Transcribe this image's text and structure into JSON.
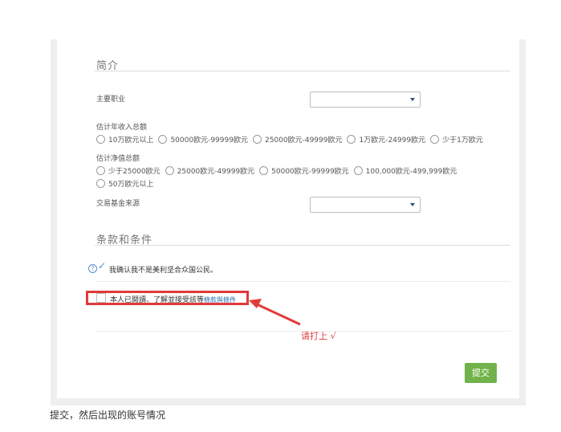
{
  "sections": {
    "intro_title": "简介",
    "terms_title": "条款和条件"
  },
  "occupation": {
    "label": "主要职业",
    "selected": ""
  },
  "annual_income": {
    "label": "估计年收入总额",
    "options": [
      "10万欧元以上",
      "50000欧元-99999欧元",
      "25000欧元-49999欧元",
      "1万欧元-24999欧元",
      "少于1万欧元"
    ]
  },
  "net_worth": {
    "label": "估计净值总额",
    "options": [
      "少于25000欧元",
      "25000欧元-49999欧元",
      "50000欧元-99999欧元",
      "100,000欧元-499,999欧元",
      "50万欧元以上"
    ]
  },
  "fund_source": {
    "label": "交易基金来源",
    "selected": ""
  },
  "terms": {
    "help_icon": "?",
    "confirm_text": "我确认我不是美利坚合众国公民。",
    "accept_text": "本人已閱讀、了解並接受該等",
    "accept_link": "條款與條件"
  },
  "annotation": {
    "note": "请打上 √",
    "color": "#e23a3a"
  },
  "submit_label": "提交",
  "caption": "提交，然后出现的账号情况",
  "colors": {
    "submit": "#72b24a",
    "link": "#2a6fb0",
    "check": "#5a8fc8"
  }
}
